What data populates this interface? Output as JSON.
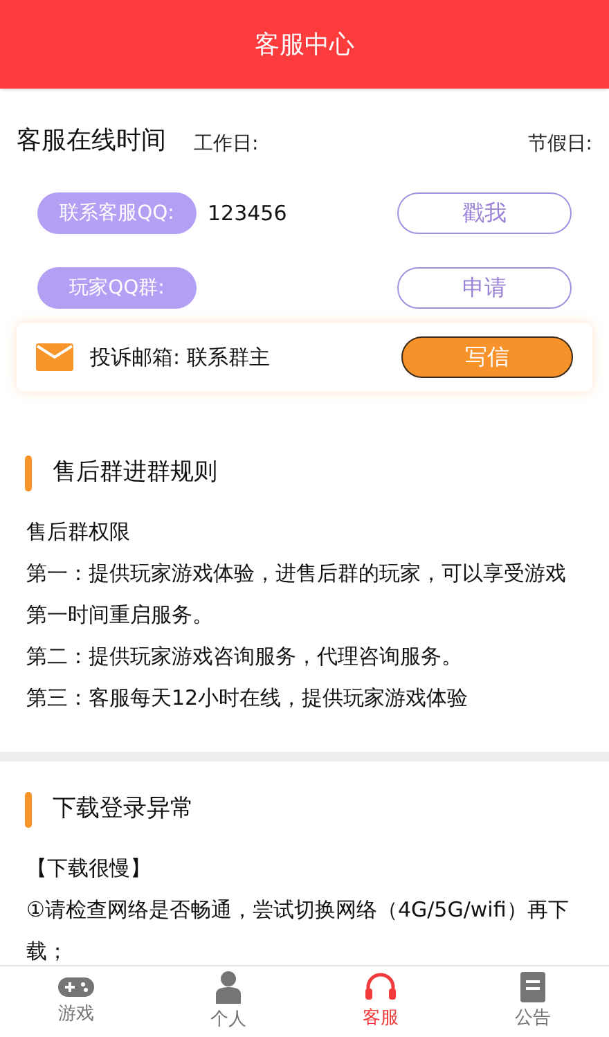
{
  "header": {
    "title": "客服中心"
  },
  "service": {
    "title": "客服在线时间",
    "workday_label": "工作日:",
    "holiday_label": "节假日:",
    "contacts": [
      {
        "label": "联系客服QQ:",
        "value": "123456",
        "action": "戳我"
      },
      {
        "label": "玩家QQ群:",
        "action": "申请"
      }
    ],
    "email": {
      "text": "投诉邮箱: 联系群主",
      "action": "写信"
    }
  },
  "sections": [
    {
      "title": "售后群进群规则",
      "paragraphs": [
        "售后群权限",
        "第一：提供玩家游戏体验，进售后群的玩家，可以享受游戏第一时间重启服务。",
        "第二：提供玩家游戏咨询服务，代理咨询服务。",
        "第三：客服每天12小时在线，提供玩家游戏体验"
      ]
    },
    {
      "title": "下载登录异常",
      "paragraphs": [
        "【下载很慢】",
        "①请检查网络是否畅通，尝试切换网络（4G/5G/wifi）再下载；"
      ]
    }
  ],
  "tabs": [
    {
      "label": "游戏",
      "kind": "gamepad",
      "selected": false
    },
    {
      "label": "个人",
      "kind": "person",
      "selected": false
    },
    {
      "label": "客服",
      "kind": "headset",
      "selected": true
    },
    {
      "label": "公告",
      "kind": "notice",
      "selected": false
    }
  ]
}
